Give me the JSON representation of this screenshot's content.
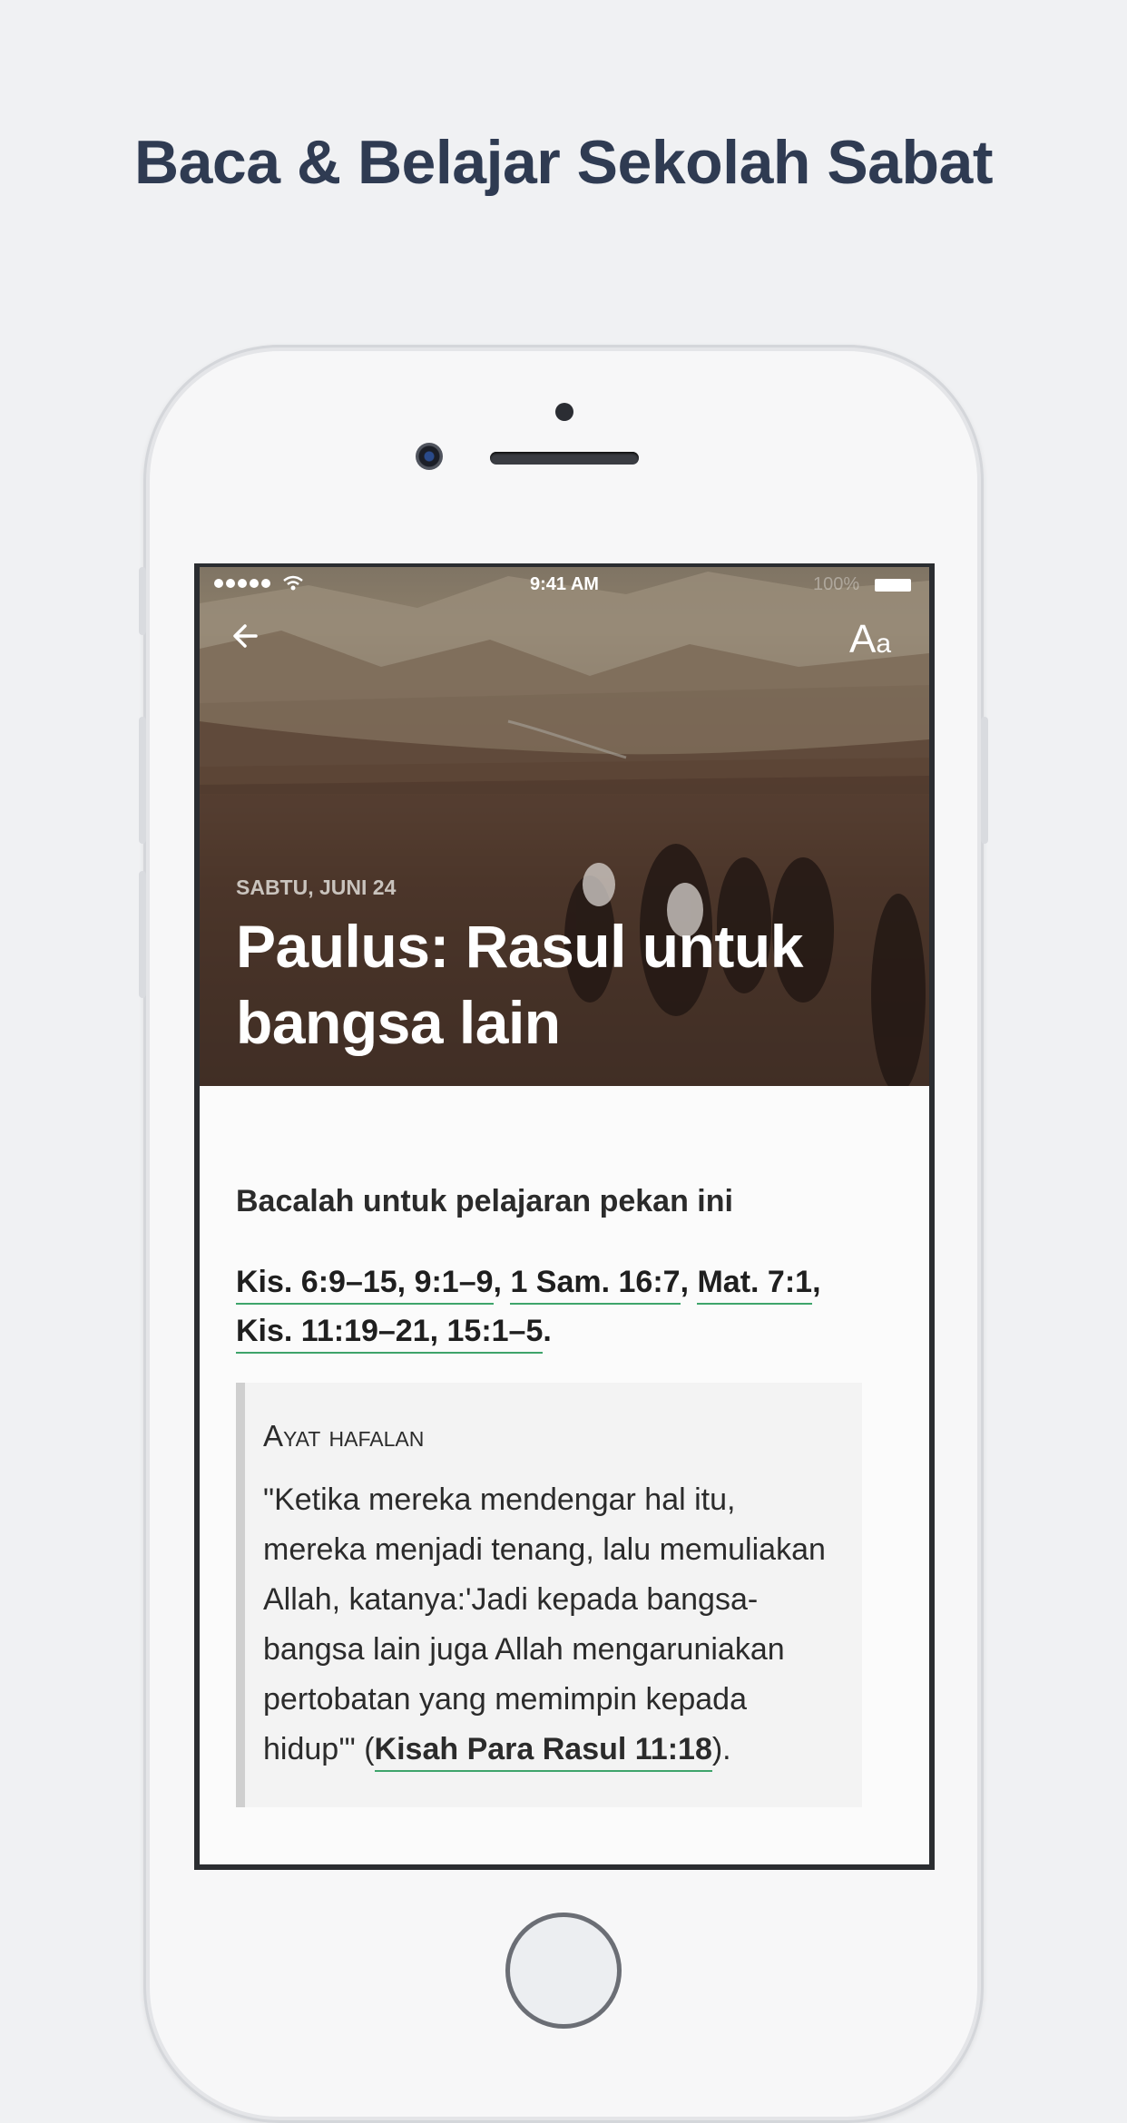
{
  "headline": "Baca & Belajar Sekolah Sabat",
  "statusbar": {
    "time": "9:41 AM",
    "battery_text": "100%"
  },
  "header": {
    "font_button": {
      "big": "A",
      "small": "a"
    }
  },
  "lesson": {
    "date": "SABTU, JUNI 24",
    "title": "Paulus: Rasul untuk bangsa lain"
  },
  "reading": {
    "label": "Bacalah untuk pelajaran pekan ini",
    "refs": [
      {
        "text": "Kis. 6:9–15, 9:1–9",
        "after": ", "
      },
      {
        "text": "1 Sam. 16:7",
        "after": ", "
      },
      {
        "text": "Mat. 7:1",
        "after": ", "
      },
      {
        "text": "Kis. 11:19–21, 15:1–5",
        "after": "."
      }
    ]
  },
  "memory_verse": {
    "label": "Ayat hafalan",
    "text": "\"Ketika mereka mendengar hal itu, mereka menjadi tenang, lalu memuliakan Allah, katanya:'Jadi kepada bangsa-bangsa lain juga Allah mengaruniakan pertobatan yang memimpin kepada hidup'\" (",
    "ref": "Kisah Para Rasul 11:18",
    "tail": ")."
  },
  "colors": {
    "headline": "#2f3b52",
    "link_underline": "#3ea46b",
    "background": "#f0f1f3"
  },
  "icons": [
    "back-arrow-icon",
    "font-size-icon",
    "wifi-icon",
    "signal-icon",
    "battery-icon"
  ]
}
